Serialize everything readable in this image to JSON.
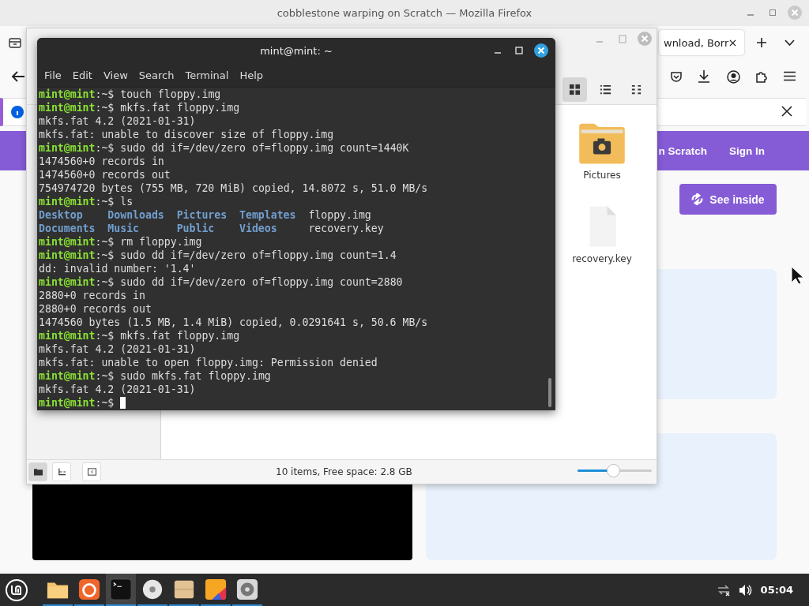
{
  "firefox": {
    "title": "cobblestone warping on Scratch — Mozilla Firefox",
    "tab": {
      "label": "wnload, Borr"
    },
    "scratch": {
      "nav_links": [
        "n Scratch",
        "Sign In"
      ],
      "see_inside": "See inside"
    }
  },
  "files": {
    "view_buttons": [
      {
        "kind": "grid",
        "selected": true
      },
      {
        "kind": "list",
        "selected": false
      },
      {
        "kind": "compact",
        "selected": false
      }
    ],
    "items": [
      {
        "name": "Pictures",
        "kind": "pictures"
      },
      {
        "name": "recovery.key",
        "kind": "file"
      }
    ],
    "side_buttons": [
      {
        "kind": "places",
        "selected": true
      },
      {
        "kind": "tree",
        "selected": false
      },
      {
        "kind": "toggle",
        "selected": false
      }
    ],
    "status": "10 items, Free space: 2.8 GB",
    "zoom": {
      "level": 0.49
    }
  },
  "terminal": {
    "title": "mint@mint: ~",
    "menu": [
      "File",
      "Edit",
      "View",
      "Search",
      "Terminal",
      "Help"
    ],
    "lines": [
      {
        "kind": "prompt",
        "user": "mint@mint",
        "suffix": ":~$",
        "command": "touch floppy.img"
      },
      {
        "kind": "prompt",
        "user": "mint@mint",
        "suffix": ":~$",
        "command": "mkfs.fat floppy.img"
      },
      {
        "kind": "output",
        "text": "mkfs.fat 4.2 (2021-01-31)"
      },
      {
        "kind": "output",
        "text": "mkfs.fat: unable to discover size of floppy.img"
      },
      {
        "kind": "prompt",
        "user": "mint@mint",
        "suffix": ":~$",
        "command": "sudo dd if=/dev/zero of=floppy.img count=1440K"
      },
      {
        "kind": "output",
        "text": "1474560+0 records in"
      },
      {
        "kind": "output",
        "text": "1474560+0 records out"
      },
      {
        "kind": "output",
        "text": "754974720 bytes (755 MB, 720 MiB) copied, 14.8072 s, 51.0 MB/s"
      },
      {
        "kind": "prompt",
        "user": "mint@mint",
        "suffix": ":~$",
        "command": "ls"
      },
      {
        "kind": "listing",
        "entries": [
          {
            "name": "Desktop",
            "kind": "dir"
          },
          {
            "name": "Downloads",
            "kind": "dir"
          },
          {
            "name": "Pictures",
            "kind": "dir"
          },
          {
            "name": "Templates",
            "kind": "dir"
          },
          {
            "name": "floppy.img",
            "kind": "file"
          }
        ]
      },
      {
        "kind": "listing",
        "entries": [
          {
            "name": "Documents",
            "kind": "dir"
          },
          {
            "name": "Music",
            "kind": "dir"
          },
          {
            "name": "Public",
            "kind": "dir"
          },
          {
            "name": "Videos",
            "kind": "dir"
          },
          {
            "name": "recovery.key",
            "kind": "file"
          }
        ]
      },
      {
        "kind": "prompt",
        "user": "mint@mint",
        "suffix": ":~$",
        "command": "rm floppy.img"
      },
      {
        "kind": "prompt",
        "user": "mint@mint",
        "suffix": ":~$",
        "command": "sudo dd if=/dev/zero of=floppy.img count=1.4"
      },
      {
        "kind": "output",
        "text": "dd: invalid number: '1.4'"
      },
      {
        "kind": "prompt",
        "user": "mint@mint",
        "suffix": ":~$",
        "command": "sudo dd if=/dev/zero of=floppy.img count=2880"
      },
      {
        "kind": "output",
        "text": "2880+0 records in"
      },
      {
        "kind": "output",
        "text": "2880+0 records out"
      },
      {
        "kind": "output",
        "text": "1474560 bytes (1.5 MB, 1.4 MiB) copied, 0.0291641 s, 50.6 MB/s"
      },
      {
        "kind": "prompt",
        "user": "mint@mint",
        "suffix": ":~$",
        "command": "mkfs.fat floppy.img"
      },
      {
        "kind": "output",
        "text": "mkfs.fat 4.2 (2021-01-31)"
      },
      {
        "kind": "output",
        "text": "mkfs.fat: unable to open floppy.img: Permission denied"
      },
      {
        "kind": "prompt",
        "user": "mint@mint",
        "suffix": ":~$",
        "command": "sudo mkfs.fat floppy.img"
      },
      {
        "kind": "output",
        "text": "mkfs.fat 4.2 (2021-01-31)"
      },
      {
        "kind": "prompt",
        "user": "mint@mint",
        "suffix": ":~$",
        "cursor": true
      }
    ]
  },
  "taskbar": {
    "apps": [
      {
        "kind": "files",
        "active": false
      },
      {
        "kind": "firefox",
        "active": false
      },
      {
        "kind": "terminal",
        "active": true
      },
      {
        "kind": "disc",
        "active": false
      },
      {
        "kind": "archive",
        "active": false
      },
      {
        "kind": "office",
        "active": false
      },
      {
        "kind": "disks",
        "active": false
      }
    ],
    "clock": "05:04"
  }
}
